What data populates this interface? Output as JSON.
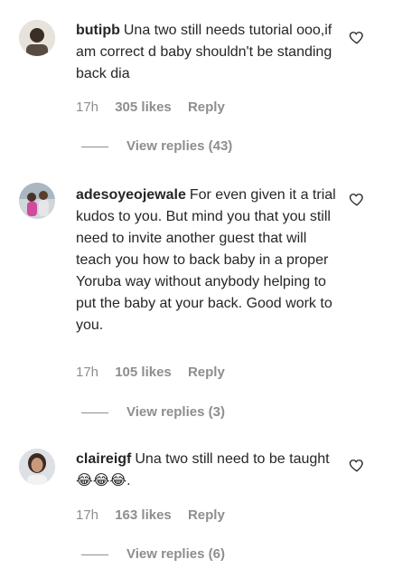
{
  "comments": [
    {
      "username": "butipb",
      "text": "Una two still needs tutorial ooo,if am correct d baby shouldn't be standing back dia",
      "time": "17h",
      "likes": "305 likes",
      "reply": "Reply",
      "view_replies": "View replies (43)"
    },
    {
      "username": "adesoyeojewale",
      "text": "For even given it a trial kudos to you. But mind you that you still need to invite another guest that will teach you how to back baby in a proper Yoruba way without anybody helping to put the baby at your back. Good work to you.",
      "time": "17h",
      "likes": "105 likes",
      "reply": "Reply",
      "view_replies": "View replies (3)"
    },
    {
      "username": "claireigf",
      "text": "Una two still need to be taught 😂😂😂.",
      "time": "17h",
      "likes": "163 likes",
      "reply": "Reply",
      "view_replies": "View replies (6)"
    }
  ]
}
